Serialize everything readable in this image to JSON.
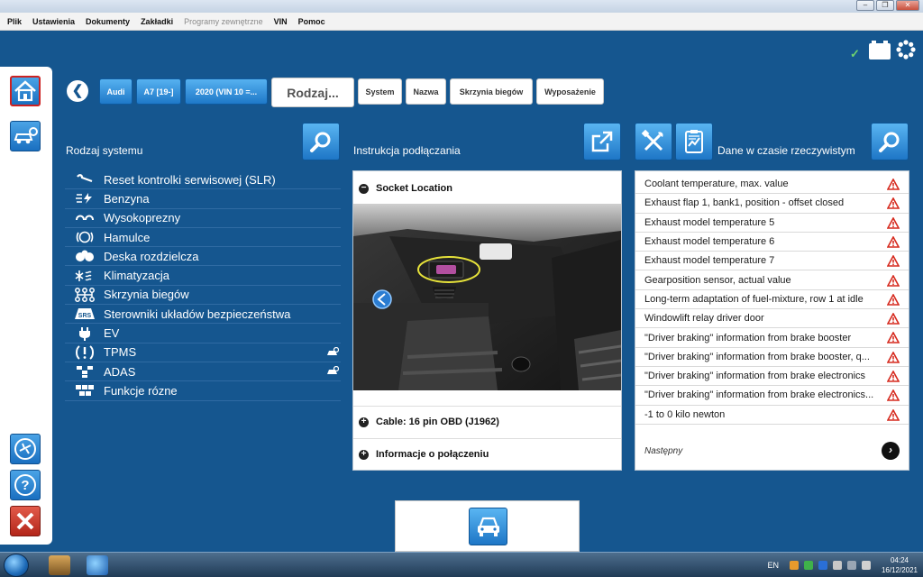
{
  "menu": [
    "Plik",
    "Ustawienia",
    "Dokumenty",
    "Zakładki",
    "Programy zewnętrzne",
    "VIN",
    "Pomoc"
  ],
  "breadcrumbs": [
    {
      "label": "Audi"
    },
    {
      "label": "A7 [19-]"
    },
    {
      "label": "2020 (VIN 10 =..."
    },
    {
      "label": "Rodzaj..."
    },
    {
      "label": "System"
    },
    {
      "label": "Nazwa"
    },
    {
      "label": "Skrzynia biegów"
    },
    {
      "label": "Wyposażenie"
    }
  ],
  "systems_panel": {
    "title": "Rodzaj systemu",
    "items": [
      {
        "label": "Reset kontrolki serwisowej (SLR)",
        "icon": "wrench-icon"
      },
      {
        "label": "Benzyna",
        "icon": "petrol-engine-icon"
      },
      {
        "label": "Wysokoprezny",
        "icon": "diesel-glowplug-icon"
      },
      {
        "label": "Hamulce",
        "icon": "brake-icon"
      },
      {
        "label": "Deska rozdzielcza",
        "icon": "dashboard-icon"
      },
      {
        "label": "Klimatyzacja",
        "icon": "air-conditioning-icon"
      },
      {
        "label": "Skrzynia biegów",
        "icon": "gearbox-icon"
      },
      {
        "label": "Sterowniki układów bezpieczeństwa",
        "icon": "srs-icon"
      },
      {
        "label": "EV",
        "icon": "ev-plug-icon"
      },
      {
        "label": "TPMS",
        "icon": "tpms-icon"
      },
      {
        "label": "ADAS",
        "icon": "adas-icon"
      },
      {
        "label": "Funkcje rózne",
        "icon": "misc-functions-icon"
      }
    ]
  },
  "connection_panel": {
    "title": "Instrukcja podłączania",
    "socket_location": "Socket Location",
    "cable": "Cable: 16 pin OBD (J1962)",
    "connection_info": "Informacje o połączeniu"
  },
  "realtime_panel": {
    "title": "Dane w czasie rzeczywistym",
    "items": [
      "Coolant temperature, max. value",
      "Exhaust flap 1, bank1, position - offset closed",
      "Exhaust model temperature 5",
      "Exhaust model temperature 6",
      "Exhaust model temperature 7",
      "Gearposition sensor, actual value",
      "Long-term adaptation of fuel-mixture, row 1 at idle",
      "Windowlift relay driver door",
      "\"Driver braking\" information from brake booster",
      "\"Driver braking\" information from brake booster, q...",
      "\"Driver braking\" information from brake electronics",
      "\"Driver braking\" information from brake electronics...",
      "-1 to 0 kilo newton"
    ],
    "next_label": "Następny"
  },
  "taskbar": {
    "lang": "EN",
    "time": "04:24",
    "date": "16/12/2021"
  }
}
